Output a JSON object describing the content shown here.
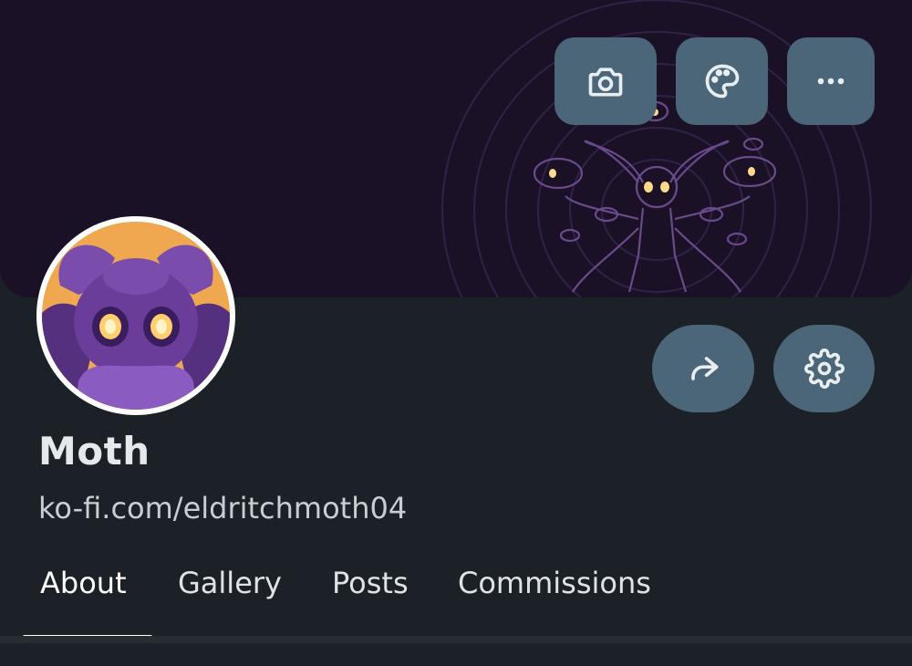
{
  "profile": {
    "name": "Moth",
    "url": "ko-fi.com/eldritchmoth04"
  },
  "banner_actions": [
    {
      "icon": "camera-icon"
    },
    {
      "icon": "palette-icon"
    },
    {
      "icon": "more-icon"
    }
  ],
  "profile_actions": [
    {
      "icon": "share-icon"
    },
    {
      "icon": "gear-icon"
    }
  ],
  "tabs": [
    {
      "label": "About",
      "active": true
    },
    {
      "label": "Gallery",
      "active": false
    },
    {
      "label": "Posts",
      "active": false
    },
    {
      "label": "Commissions",
      "active": false
    }
  ],
  "colors": {
    "page_bg": "#1b2126",
    "banner_bg": "#1a1127",
    "button_bg": "#4a6678",
    "avatar_bg": "#f0a850",
    "moth_purple": "#6a3d9a"
  }
}
